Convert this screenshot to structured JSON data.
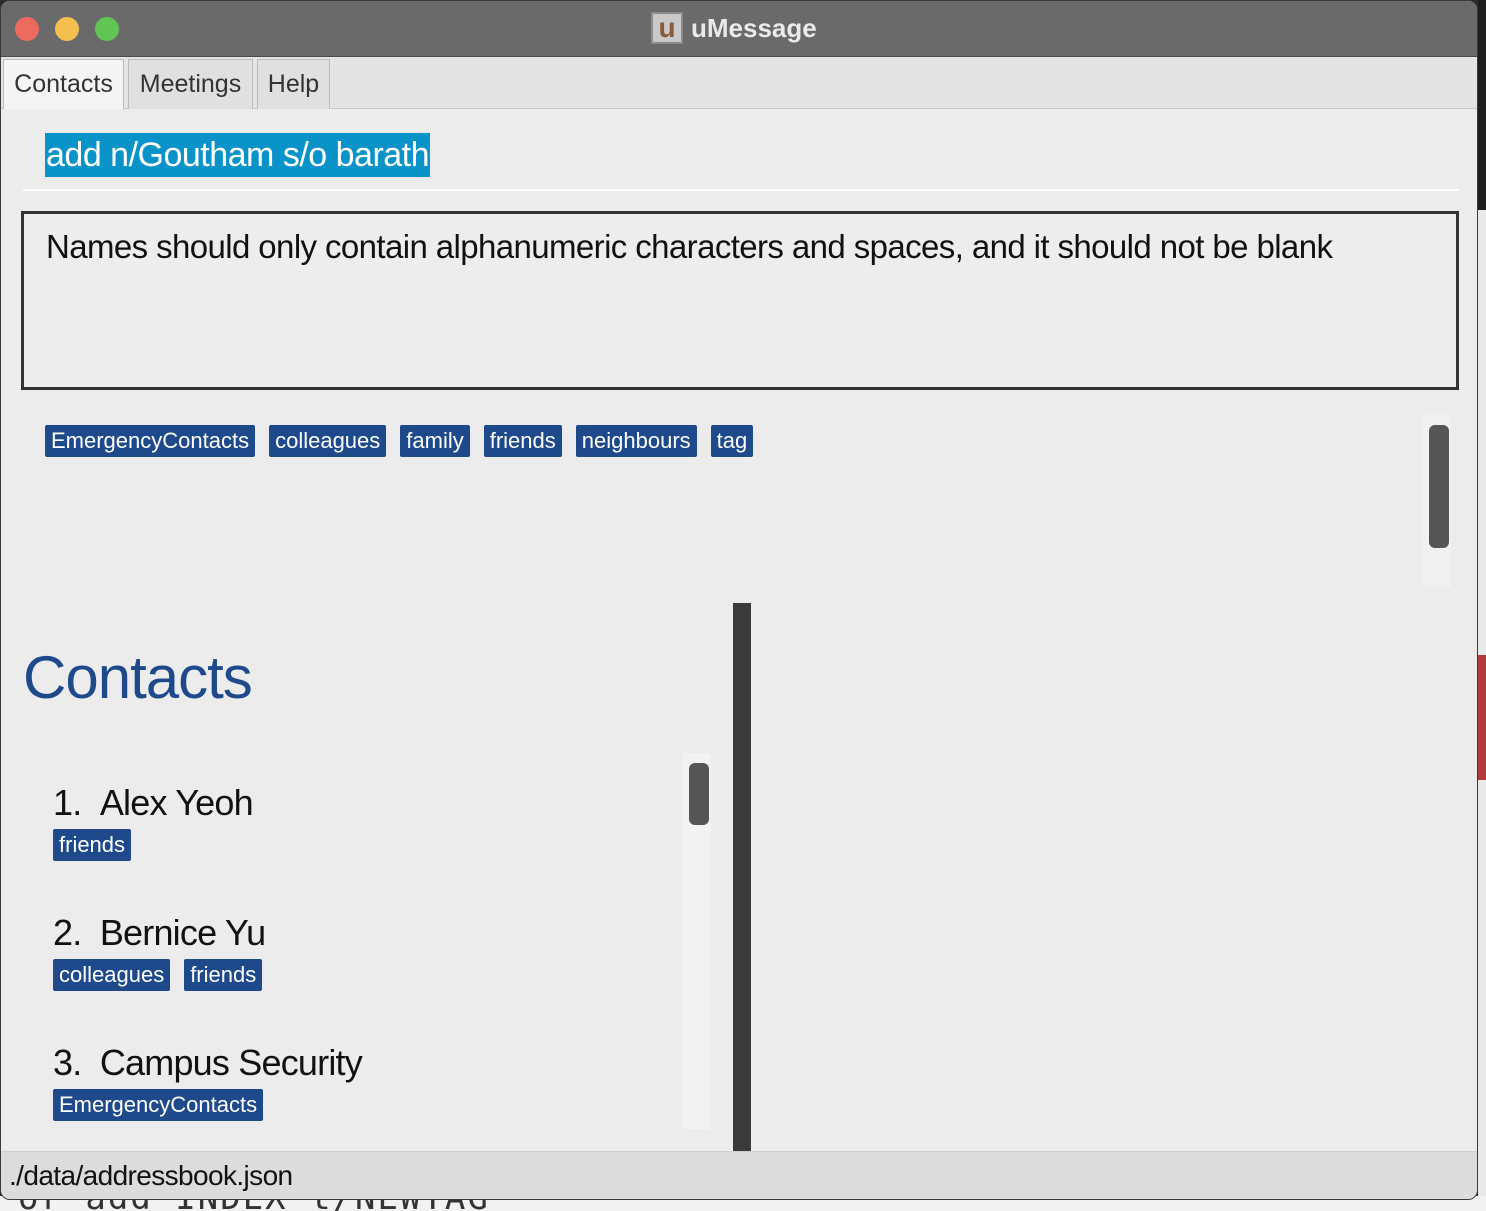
{
  "window": {
    "title": "uMessage",
    "icon_letter": "u"
  },
  "menu": {
    "items": [
      {
        "label": "Contacts",
        "active": true
      },
      {
        "label": "Meetings",
        "active": false
      },
      {
        "label": "Help",
        "active": false
      }
    ]
  },
  "command": {
    "value": "add n/Goutham s/o barath"
  },
  "result": {
    "message": "Names should only contain alphanumeric characters and spaces, and it should not be blank"
  },
  "tags": [
    "EmergencyContacts",
    "colleagues",
    "family",
    "friends",
    "neighbours",
    "tag"
  ],
  "contacts": {
    "heading": "Contacts",
    "items": [
      {
        "index": "1.",
        "name": "Alex Yeoh",
        "tags": [
          "friends"
        ]
      },
      {
        "index": "2.",
        "name": "Bernice Yu",
        "tags": [
          "colleagues",
          "friends"
        ]
      },
      {
        "index": "3.",
        "name": "Campus Security",
        "tags": [
          "EmergencyContacts"
        ]
      }
    ]
  },
  "status": {
    "file_path": "./data/addressbook.json"
  },
  "background": {
    "terminal_text": "or add INDEX t/NEWTAG"
  },
  "colors": {
    "accent": "#1e4a8c",
    "selection": "#0a93c8",
    "titlebar": "#6a6a6a"
  }
}
